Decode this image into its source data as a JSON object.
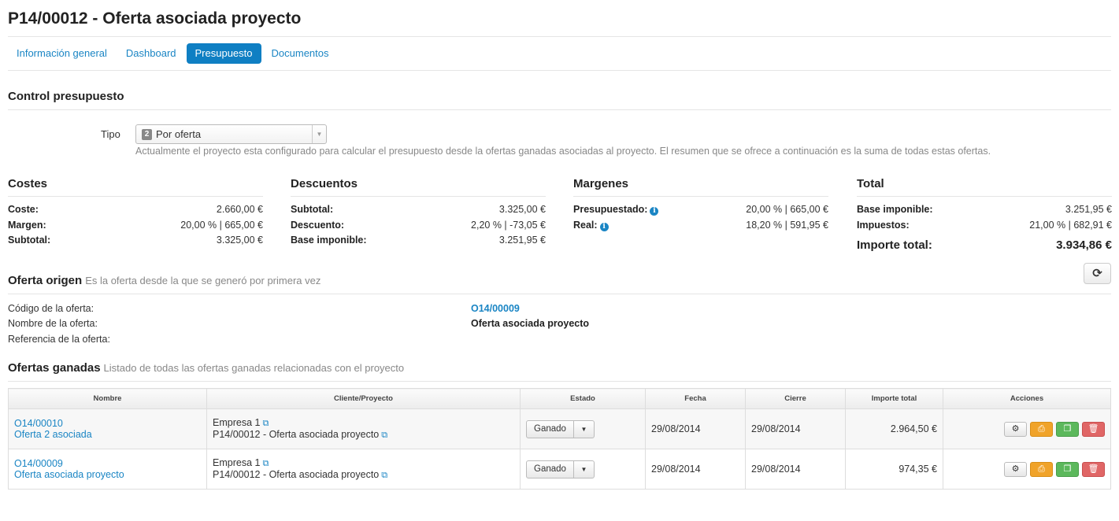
{
  "title": "P14/00012 - Oferta asociada proyecto",
  "tabs": [
    {
      "label": "Información general"
    },
    {
      "label": "Dashboard"
    },
    {
      "label": "Presupuesto"
    },
    {
      "label": "Documentos"
    }
  ],
  "control": {
    "title": "Control presupuesto",
    "tipo_label": "Tipo",
    "tipo_number": "2",
    "tipo_value": "Por oferta",
    "help": "Actualmente el proyecto esta configurado para calcular el presupuesto desde la ofertas ganadas asociadas al proyecto. El resumen que se ofrece a continuación es la suma de todas estas ofertas."
  },
  "costes": {
    "title": "Costes",
    "rows": [
      {
        "k": "Coste:",
        "v": "2.660,00 €"
      },
      {
        "k": "Margen:",
        "v": "20,00 % | 665,00 €"
      },
      {
        "k": "Subtotal:",
        "v": "3.325,00 €"
      }
    ]
  },
  "descuentos": {
    "title": "Descuentos",
    "rows": [
      {
        "k": "Subtotal:",
        "v": "3.325,00 €"
      },
      {
        "k": "Descuento:",
        "v": "2,20 % | -73,05 €"
      },
      {
        "k": "Base imponible:",
        "v": "3.251,95 €"
      }
    ]
  },
  "margenes": {
    "title": "Margenes",
    "rows": [
      {
        "k": "Presupuestado:",
        "v": "20,00 % | 665,00 €"
      },
      {
        "k": "Real:",
        "v": "18,20 % | 591,95 €"
      }
    ]
  },
  "total": {
    "title": "Total",
    "rows": [
      {
        "k": "Base imponible:",
        "v": "3.251,95 €"
      },
      {
        "k": "Impuestos:",
        "v": "21,00 % | 682,91 €"
      }
    ],
    "importe_label": "Importe total:",
    "importe_value": "3.934,86 €"
  },
  "origen": {
    "title": "Oferta origen",
    "subtitle": "Es la oferta desde la que se generó por primera vez",
    "codigo_label": "Código de la oferta:",
    "codigo_value": "O14/00009",
    "nombre_label": "Nombre de la oferta:",
    "nombre_value": "Oferta asociada proyecto",
    "referencia_label": "Referencia de la oferta:"
  },
  "ganadas": {
    "title": "Ofertas ganadas",
    "subtitle": "Listado de todas las ofertas ganadas relacionadas con el proyecto",
    "columns": [
      "Nombre",
      "Cliente/Proyecto",
      "Estado",
      "Fecha",
      "Cierre",
      "Importe total",
      "Acciones"
    ],
    "rows": [
      {
        "codigo": "O14/00010",
        "nombre": "Oferta 2 asociada",
        "cliente": "Empresa 1",
        "proyecto": "P14/00012 - Oferta asociada proyecto",
        "estado": "Ganado",
        "fecha": "29/08/2014",
        "cierre": "29/08/2014",
        "importe": "2.964,50 €"
      },
      {
        "codigo": "O14/00009",
        "nombre": "Oferta asociada proyecto",
        "cliente": "Empresa 1",
        "proyecto": "P14/00012 - Oferta asociada proyecto",
        "estado": "Ganado",
        "fecha": "29/08/2014",
        "cierre": "29/08/2014",
        "importe": "974,35 €"
      }
    ]
  }
}
